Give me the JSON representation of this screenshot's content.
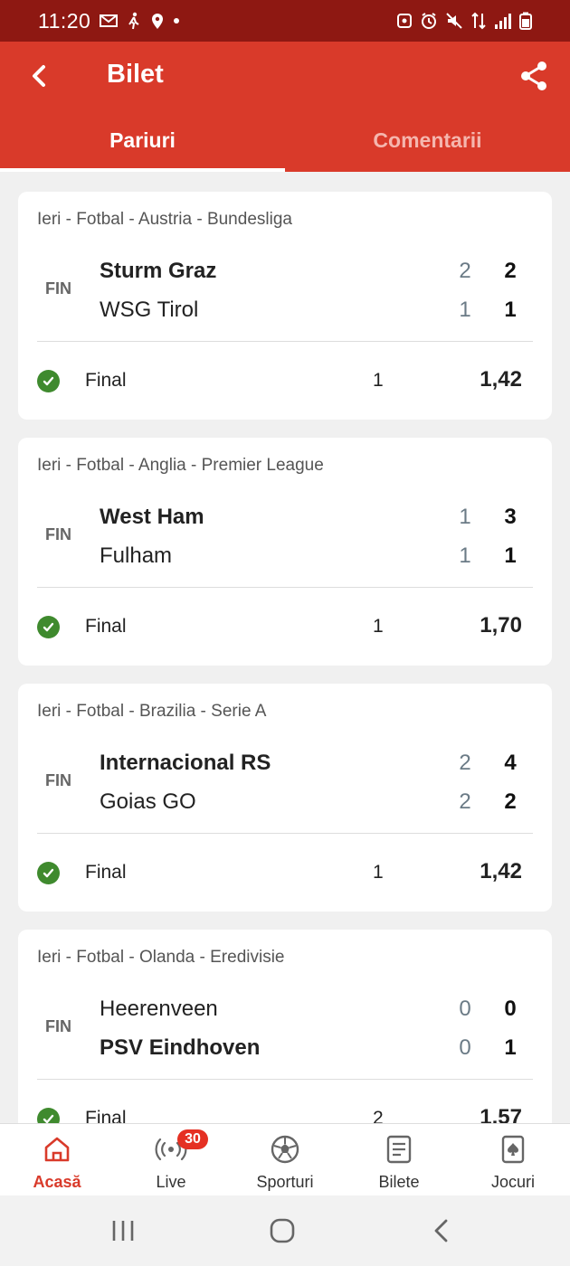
{
  "status_bar": {
    "time": "11:20"
  },
  "app_bar": {
    "title": "Bilet"
  },
  "tabs": [
    {
      "label": "Pariuri",
      "active": true
    },
    {
      "label": "Comentarii",
      "active": false
    }
  ],
  "cards": [
    {
      "league": "Ieri - Fotbal - Austria - Bundesliga",
      "status": "FIN",
      "home": {
        "name": "Sturm Graz",
        "ht": "2",
        "ft": "2",
        "winner": true
      },
      "away": {
        "name": "WSG Tirol",
        "ht": "1",
        "ft": "1",
        "winner": false
      },
      "market": "Final",
      "pick": "1",
      "odds": "1,42"
    },
    {
      "league": "Ieri - Fotbal - Anglia - Premier League",
      "status": "FIN",
      "home": {
        "name": "West Ham",
        "ht": "1",
        "ft": "3",
        "winner": true
      },
      "away": {
        "name": "Fulham",
        "ht": "1",
        "ft": "1",
        "winner": false
      },
      "market": "Final",
      "pick": "1",
      "odds": "1,70"
    },
    {
      "league": "Ieri - Fotbal - Brazilia - Serie A",
      "status": "FIN",
      "home": {
        "name": "Internacional RS",
        "ht": "2",
        "ft": "4",
        "winner": true
      },
      "away": {
        "name": "Goias GO",
        "ht": "2",
        "ft": "2",
        "winner": false
      },
      "market": "Final",
      "pick": "1",
      "odds": "1,42"
    },
    {
      "league": "Ieri - Fotbal - Olanda - Eredivisie",
      "status": "FIN",
      "home": {
        "name": "Heerenveen",
        "ht": "0",
        "ft": "0",
        "winner": false
      },
      "away": {
        "name": "PSV Eindhoven",
        "ht": "0",
        "ft": "1",
        "winner": true
      },
      "market": "Final",
      "pick": "2",
      "odds": "1,57"
    }
  ],
  "bottom_nav": [
    {
      "label": "Acasă",
      "icon": "home-icon",
      "active": true
    },
    {
      "label": "Live",
      "icon": "live-icon",
      "active": false,
      "badge": "30"
    },
    {
      "label": "Sporturi",
      "icon": "soccer-ball-icon",
      "active": false
    },
    {
      "label": "Bilete",
      "icon": "ticket-list-icon",
      "active": false
    },
    {
      "label": "Jocuri",
      "icon": "cards-icon",
      "active": false
    }
  ],
  "colors": {
    "primary": "#d93a2a",
    "status_bar": "#8e1812",
    "win_check": "#3f8a2e",
    "badge": "#e53023"
  }
}
